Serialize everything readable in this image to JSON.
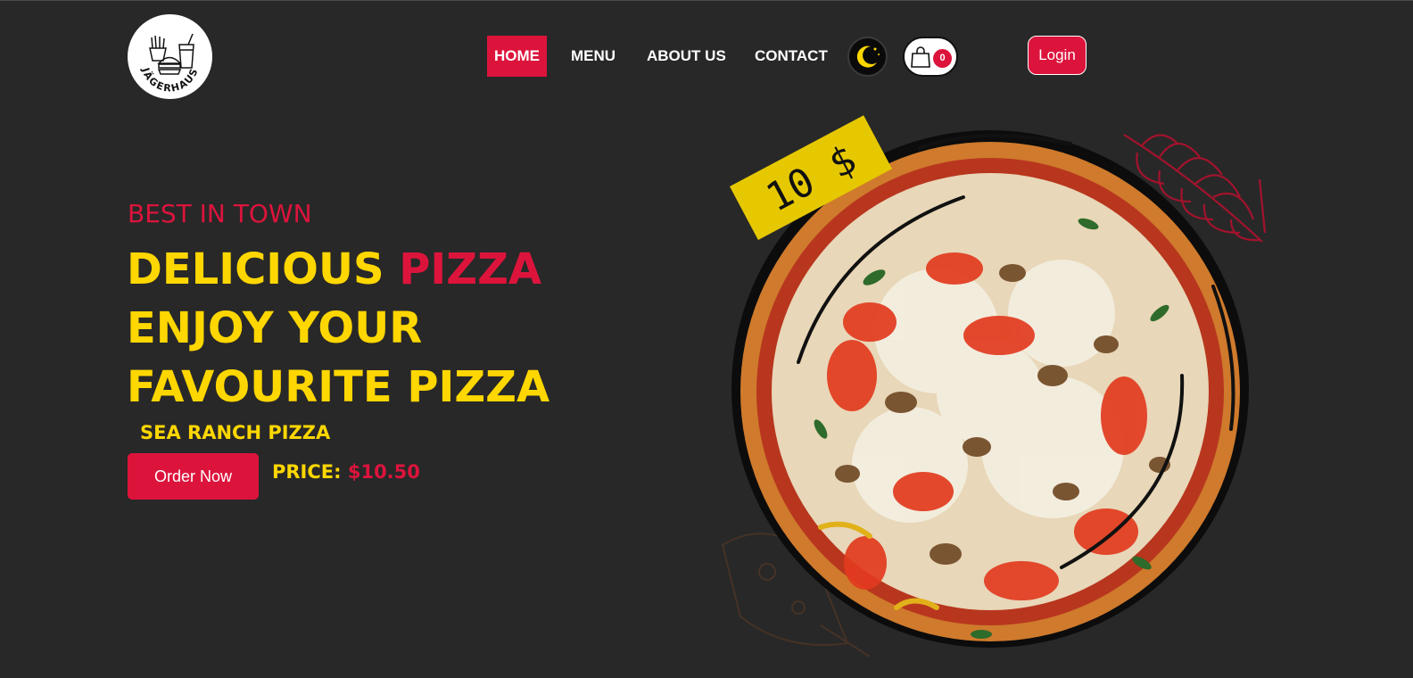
{
  "brand": {
    "logo_text": "JÄGERHAUS"
  },
  "nav": {
    "items": [
      {
        "label": "HOME",
        "active": true
      },
      {
        "label": "MENU",
        "active": false
      },
      {
        "label": "ABOUT US",
        "active": false
      },
      {
        "label": "CONTACT",
        "active": false
      }
    ],
    "theme_icon": "moon-icon",
    "cart_icon": "shopping-bag-icon",
    "cart_count": "0",
    "login_label": "Login"
  },
  "hero": {
    "eyebrow": "BEST IN TOWN",
    "headline_line1_a": "DELICIOUS",
    "headline_line1_b": "PIZZA",
    "headline_line2": "ENJOY YOUR",
    "headline_line3": "FAVOURITE PIZZA",
    "product_name": "SEA RANCH PIZZA",
    "order_button": "Order Now",
    "price_label": "PRICE:",
    "price_value": "$10.50",
    "price_tag": "10 $"
  },
  "colors": {
    "background": "#282828",
    "accent": "#dc143c",
    "highlight": "#ffd700",
    "price_tag": "#e6c800"
  }
}
